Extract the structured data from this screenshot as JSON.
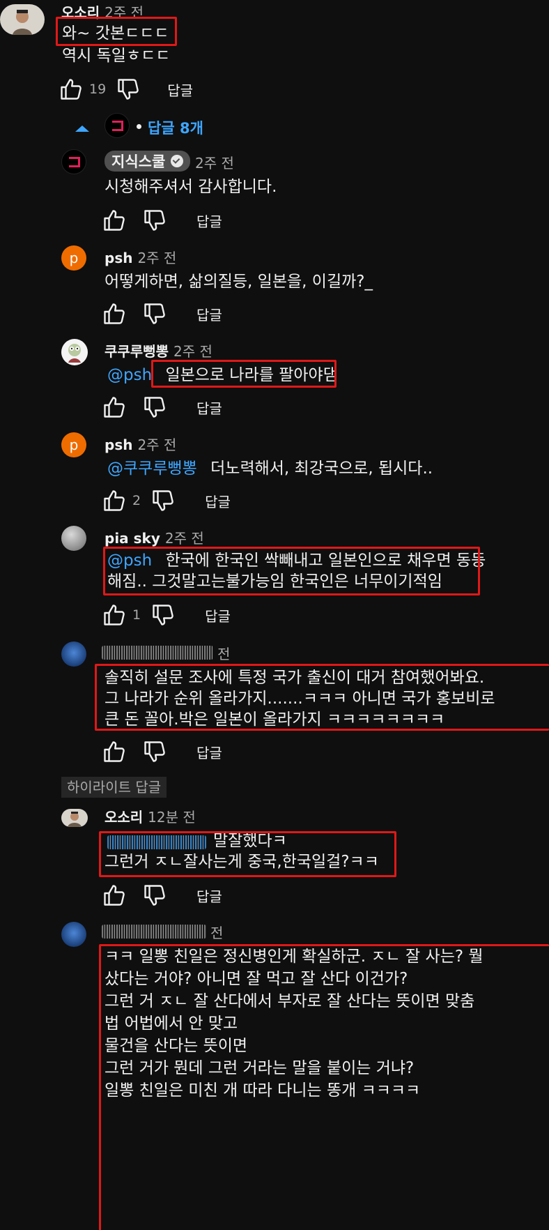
{
  "top_comment": {
    "author": "오소리",
    "time": "2주 전",
    "lines": [
      "와~ 갓본ㄷㄷㄷ",
      "역시 독일ㅎㄷㄷ"
    ],
    "likes": "19",
    "reply_label": "답글"
  },
  "replies_toggle": {
    "label": "답글 8개"
  },
  "replies": [
    {
      "author": "지식스쿨",
      "time": "2주 전",
      "text": "시청해주셔서 감사합니다.",
      "likes": "",
      "reply_label": "답글"
    },
    {
      "author": "psh",
      "avatar_letter": "p",
      "time": "2주 전",
      "text": "어떻게하면, 삶의질등, 일본을, 이길까?_",
      "likes": "",
      "reply_label": "답글"
    },
    {
      "author": "쿠쿠루뻥뽕",
      "time": "2주 전",
      "mention": "@psh",
      "text": "일본으로 나라를 팔아야댐",
      "likes": "",
      "reply_label": "답글"
    },
    {
      "author": "psh",
      "avatar_letter": "p",
      "time": "2주 전",
      "mention": "@쿠쿠루뻥뽕",
      "text": "더노력해서, 최강국으로, 됩시다..",
      "likes": "2",
      "reply_label": "답글"
    },
    {
      "author": "pia sky",
      "time": "2주 전",
      "mention": "@psh",
      "lines": [
        "한국에 한국인 싹빼내고 일본인으로 채우면 동등",
        "해짐.. 그것말고는불가능임 한국인은 너무이기적임"
      ],
      "likes": "1",
      "reply_label": "답글"
    },
    {
      "time": "전",
      "lines": [
        "솔직히 설문 조사에 특정 국가 출신이 대거 참여했어봐요.",
        "그 나라가 순위 올라가지.......ㅋㅋㅋ 아니면 국가 홍보비로",
        "큰 돈 꼴아.박은 일본이 올라가지 ㅋㅋㅋㅋㅋㅋㅋㅋ"
      ],
      "likes": "",
      "reply_label": "답글"
    }
  ],
  "highlight_label": "하이라이트 답글",
  "highlight_reply": {
    "author": "오소리",
    "time": "12분 전",
    "text1": "말잘했다ㅋ",
    "text2": "그런거 ㅈㄴ잘사는게 중국,한국일걸?ㅋㅋ",
    "reply_label": "답글"
  },
  "last_reply": {
    "time": "전",
    "lines": [
      "ㅋㅋ 일뽕 친일은 정신병인게 확실하군. ㅈㄴ 잘 사는? 뭘",
      "샀다는 거야? 아니면 잘 먹고 잘 산다 이건가?",
      "그런 거 ㅈㄴ 잘 산다에서  부자로 잘 산다는 뜻이면 맞춤",
      "법 어법에서 안 맞고",
      "물건을 산다는 뜻이면",
      "그런 거가 뭔데 그런 거라는 말을 붙이는 거냐?",
      "일뽕 친일은 미친 개 따라 다니는 똥개 ㅋㅋㅋㅋ"
    ]
  },
  "colors": {
    "background": "#0f0f0f",
    "link": "#3ea6ff",
    "highlight_box": "#e01818",
    "psh_avatar": "#ef6c00"
  }
}
